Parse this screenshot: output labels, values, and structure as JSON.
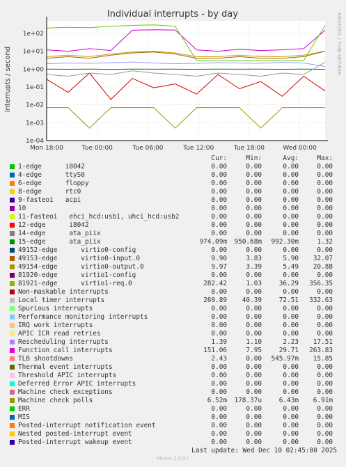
{
  "chart_data": {
    "type": "line",
    "title": "Individual interrupts - by day",
    "ylabel": "interrupts / second",
    "y_scale": "log",
    "ylim": [
      0.0001,
      500
    ],
    "y_ticks": [
      {
        "v": 100,
        "label": "1e+02"
      },
      {
        "v": 10,
        "label": "1e+01"
      },
      {
        "v": 1,
        "label": "1e+00"
      },
      {
        "v": 0.1,
        "label": "1e-01"
      },
      {
        "v": 0.01,
        "label": "1e-02"
      },
      {
        "v": 0.001,
        "label": "1e-03"
      },
      {
        "v": 0.0001,
        "label": "1e-04"
      }
    ],
    "x_range_hours": [
      -6,
      27
    ],
    "x_ticks": [
      {
        "v": -6,
        "label": "Mon 18:00"
      },
      {
        "v": 0,
        "label": "Tue 00:00"
      },
      {
        "v": 6,
        "label": "Tue 06:00"
      },
      {
        "v": 12,
        "label": "Tue 12:00"
      },
      {
        "v": 18,
        "label": "Tue 18:00"
      },
      {
        "v": 24,
        "label": "Wed 00:00"
      }
    ],
    "grid": true,
    "side_label": "RRDTOOL / TOBI OETIKER",
    "series": [
      {
        "name": "Local timer interrupts",
        "color": "#cc0000",
        "values": [
          0.27,
          0.05,
          0.6,
          0.02,
          0.3,
          0.09,
          0.15,
          0.04,
          0.5,
          0.08,
          0.2,
          0.03,
          0.4,
          0.06
        ]
      },
      {
        "name": "49152-edge virtio0-config",
        "color": "#999900",
        "values": [
          0.007,
          0.007,
          0.0005,
          0.007,
          0.007,
          0.007,
          0.0005,
          0.007,
          0.007,
          0.007,
          0.0005,
          0.007,
          0.007,
          0.007
        ]
      },
      {
        "name": "Function call interrupts",
        "color": "#cc00cc",
        "values": [
          12,
          10,
          14,
          11,
          150,
          160,
          155,
          12,
          10,
          13,
          11,
          12,
          14,
          151
        ]
      },
      {
        "name": "81921-edge virtio1-req.0",
        "color": "#66cc00",
        "values": [
          200,
          220,
          210,
          250,
          280,
          300,
          250,
          3,
          3,
          3,
          3,
          3,
          3,
          282
        ]
      },
      {
        "name": "49154-edge virtio0-output.0",
        "color": "#cc9900",
        "values": [
          5,
          6,
          5,
          7,
          9,
          10,
          8,
          5,
          5,
          6,
          5,
          5,
          6,
          10
        ]
      },
      {
        "name": "49153-edge virtio0-input.0",
        "color": "#996600",
        "values": [
          4,
          5,
          4,
          6,
          8,
          9,
          7,
          4,
          4,
          5,
          4,
          4,
          5,
          9.9
        ]
      },
      {
        "name": "15-edge ata_piix",
        "color": "#006600",
        "values": [
          1.0,
          0.98,
          1.01,
          0.97,
          1.0,
          0.99,
          1.0,
          0.98,
          1.0,
          0.99,
          1.0,
          0.98,
          1.0,
          0.974
        ]
      },
      {
        "name": "Rescheduling interrupts",
        "color": "#9999ff",
        "values": [
          2,
          2.2,
          2.1,
          2.3,
          2.5,
          2.2,
          2.0,
          2.1,
          2.3,
          2.2,
          2.1,
          2.4,
          2.2,
          1.39
        ]
      },
      {
        "name": "TLB shootdowns",
        "color": "#999999",
        "values": [
          0.5,
          0.4,
          0.6,
          0.5,
          0.8,
          0.6,
          0.5,
          0.4,
          0.6,
          0.5,
          0.4,
          0.6,
          0.5,
          2.43
        ]
      }
    ]
  },
  "legend": {
    "headers": {
      "cur": "Cur:",
      "min": "Min:",
      "avg": "Avg:",
      "max": "Max:"
    },
    "rows": [
      {
        "color": "#00cc00",
        "name": "1-edge      i8042",
        "cur": "0.00",
        "min": "0.00",
        "avg": "0.00",
        "max": "0.00"
      },
      {
        "color": "#0066b3",
        "name": "4-edge      ttyS0",
        "cur": "0.00",
        "min": "0.00",
        "avg": "0.00",
        "max": "0.00"
      },
      {
        "color": "#ff8000",
        "name": "6-edge      floppy",
        "cur": "0.00",
        "min": "0.00",
        "avg": "0.00",
        "max": "0.00"
      },
      {
        "color": "#ffcc00",
        "name": "8-edge      rtc0",
        "cur": "0.00",
        "min": "0.00",
        "avg": "0.00",
        "max": "0.00"
      },
      {
        "color": "#330099",
        "name": "9-fasteoi   acpi",
        "cur": "0.00",
        "min": "0.00",
        "avg": "0.00",
        "max": "0.00"
      },
      {
        "color": "#990099",
        "name": "10",
        "cur": "0.00",
        "min": "0.00",
        "avg": "0.00",
        "max": "0.00"
      },
      {
        "color": "#ccff00",
        "name": "11-fasteoi   ehci_hcd:usb1, uhci_hcd:usb2",
        "cur": "0.00",
        "min": "0.00",
        "avg": "0.00",
        "max": "0.00"
      },
      {
        "color": "#ff0000",
        "name": "12-edge      i8042",
        "cur": "0.00",
        "min": "0.00",
        "avg": "0.00",
        "max": "0.00"
      },
      {
        "color": "#808080",
        "name": "14-edge      ata_piix",
        "cur": "0.00",
        "min": "0.00",
        "avg": "0.00",
        "max": "0.00"
      },
      {
        "color": "#008f00",
        "name": "15-edge      ata_piix",
        "cur": "974.09m",
        "min": "950.68m",
        "avg": "992.30m",
        "max": "1.32"
      },
      {
        "color": "#00487d",
        "name": "49152-edge      virtio0-config",
        "cur": "0.00",
        "min": "0.00",
        "avg": "0.00",
        "max": "0.00"
      },
      {
        "color": "#b35a00",
        "name": "49153-edge      virtio0-input.0",
        "cur": "9.90",
        "min": "3.83",
        "avg": "5.90",
        "max": "32.07"
      },
      {
        "color": "#b38f00",
        "name": "49154-edge      virtio0-output.0",
        "cur": "9.97",
        "min": "3.39",
        "avg": "5.49",
        "max": "20.88"
      },
      {
        "color": "#6b006b",
        "name": "81920-edge      virtio1-config",
        "cur": "0.00",
        "min": "0.00",
        "avg": "0.00",
        "max": "0.00"
      },
      {
        "color": "#8fb300",
        "name": "81921-edge      virtio1-req.0",
        "cur": "282.42",
        "min": "1.03",
        "avg": "36.29",
        "max": "356.35"
      },
      {
        "color": "#b30000",
        "name": "Non-maskable interrupts",
        "cur": "0.00",
        "min": "0.00",
        "avg": "0.00",
        "max": "0.00"
      },
      {
        "color": "#bebebe",
        "name": "Local timer interrupts",
        "cur": "269.89",
        "min": "40.39",
        "avg": "72.51",
        "max": "332.63"
      },
      {
        "color": "#80ff80",
        "name": "Spurious interrupts",
        "cur": "0.00",
        "min": "0.00",
        "avg": "0.00",
        "max": "0.00"
      },
      {
        "color": "#80c9ff",
        "name": "Performance monitoring interrupts",
        "cur": "0.00",
        "min": "0.00",
        "avg": "0.00",
        "max": "0.00"
      },
      {
        "color": "#ffc080",
        "name": "IRQ work interrupts",
        "cur": "0.00",
        "min": "0.00",
        "avg": "0.00",
        "max": "0.00"
      },
      {
        "color": "#ffe680",
        "name": "APIC ICR read retries",
        "cur": "0.00",
        "min": "0.00",
        "avg": "0.00",
        "max": "0.00"
      },
      {
        "color": "#aa80ff",
        "name": "Rescheduling interrupts",
        "cur": "1.39",
        "min": "1.10",
        "avg": "2.23",
        "max": "17.51"
      },
      {
        "color": "#ee00cc",
        "name": "Function call interrupts",
        "cur": "151.06",
        "min": "7.95",
        "avg": "29.71",
        "max": "263.83"
      },
      {
        "color": "#ff8080",
        "name": "TLB shootdowns",
        "cur": "2.43",
        "min": "0.00",
        "avg": "545.97m",
        "max": "15.85"
      },
      {
        "color": "#666600",
        "name": "Thermal event interrupts",
        "cur": "0.00",
        "min": "0.00",
        "avg": "0.00",
        "max": "0.00"
      },
      {
        "color": "#ffbfff",
        "name": "Threshold APIC interrupts",
        "cur": "0.00",
        "min": "0.00",
        "avg": "0.00",
        "max": "0.00"
      },
      {
        "color": "#00ffcc",
        "name": "Deferred Error APIC interrupts",
        "cur": "0.00",
        "min": "0.00",
        "avg": "0.00",
        "max": "0.00"
      },
      {
        "color": "#cc6699",
        "name": "Machine check exceptions",
        "cur": "0.00",
        "min": "0.00",
        "avg": "0.00",
        "max": "0.00"
      },
      {
        "color": "#999900",
        "name": "Machine check polls",
        "cur": "6.52m",
        "min": "178.37u",
        "avg": "6.43m",
        "max": "6.91m"
      },
      {
        "color": "#00cc00",
        "name": "ERR",
        "cur": "0.00",
        "min": "0.00",
        "avg": "0.00",
        "max": "0.00"
      },
      {
        "color": "#0066b3",
        "name": "MIS",
        "cur": "0.00",
        "min": "0.00",
        "avg": "0.00",
        "max": "0.00"
      },
      {
        "color": "#ff8000",
        "name": "Posted-interrupt notification event",
        "cur": "0.00",
        "min": "0.00",
        "avg": "0.00",
        "max": "0.00"
      },
      {
        "color": "#ffcc00",
        "name": "Nested posted-interrupt event",
        "cur": "0.00",
        "min": "0.00",
        "avg": "0.00",
        "max": "0.00"
      },
      {
        "color": "#330099",
        "name": "Posted-interrupt wakeup event",
        "cur": "0.00",
        "min": "0.00",
        "avg": "0.00",
        "max": "0.00"
      }
    ]
  },
  "last_update": "Last update: Wed Dec 10 02:45:00 2025",
  "footer": "Munin 2.0.57"
}
